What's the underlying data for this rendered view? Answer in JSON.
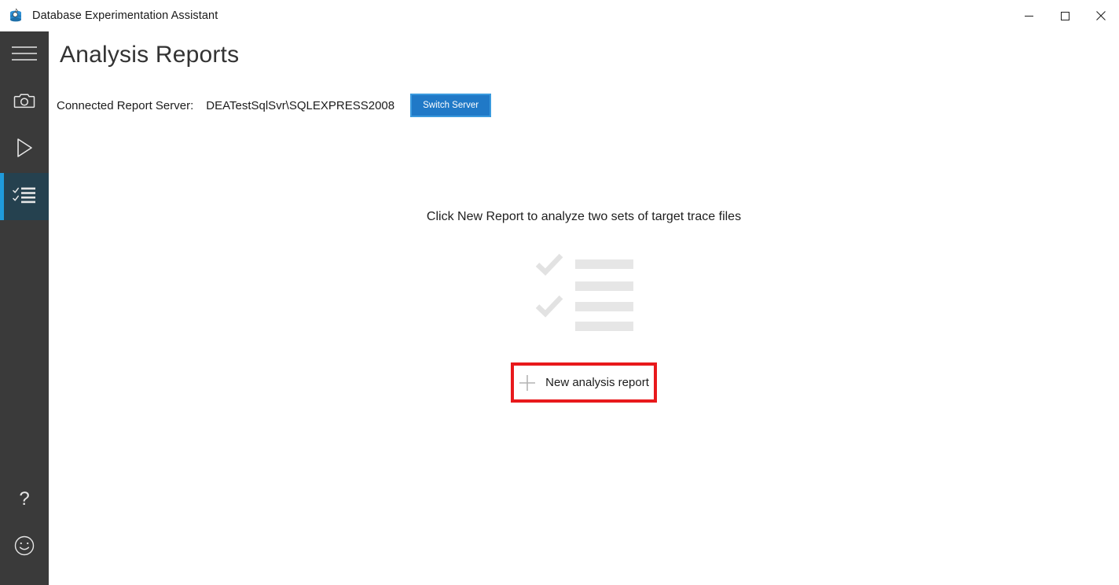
{
  "window": {
    "title": "Database Experimentation Assistant",
    "app_icon": "database-app-icon",
    "controls": {
      "minimize": "minimize-icon",
      "maximize": "maximize-icon",
      "close": "close-icon"
    }
  },
  "sidebar": {
    "background": "#3a3a3a",
    "active_background": "#25414f",
    "accent": "#1f9bdc",
    "items": [
      {
        "id": "menu",
        "icon": "hamburger-menu-icon",
        "active": false
      },
      {
        "id": "capture",
        "icon": "camera-icon",
        "active": false
      },
      {
        "id": "replay",
        "icon": "play-icon",
        "active": false
      },
      {
        "id": "analysis-reports",
        "icon": "checklist-icon",
        "active": true
      }
    ],
    "bottom_items": [
      {
        "id": "help",
        "icon": "question-mark-icon"
      },
      {
        "id": "feedback",
        "icon": "smiley-face-icon"
      }
    ]
  },
  "main": {
    "page_title": "Analysis Reports",
    "server": {
      "label": "Connected Report Server:",
      "value": "DEATestSqlSvr\\SQLEXPRESS2008",
      "switch_button": "Switch Server",
      "switch_button_color": "#2079c7",
      "switch_button_border": "#3a9ade"
    },
    "empty_state": {
      "message": "Click New Report to analyze two sets of target trace files",
      "illustration": {
        "icon": "checklist-placeholder-illustration",
        "bar_color": "#e6e6e6",
        "check_color": "#e2e2e2",
        "bars": 4,
        "checks": 2
      },
      "new_report_button": {
        "label": "New analysis report",
        "icon": "plus-icon",
        "highlight_color": "#e8191c"
      }
    }
  }
}
